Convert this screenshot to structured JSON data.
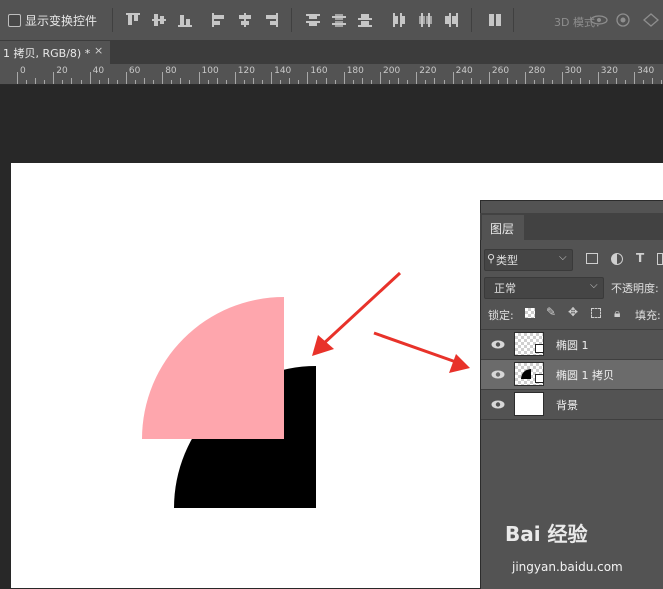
{
  "options_bar": {
    "show_transform_controls_label": "显示变换控件",
    "mode_3d_label": "3D 模式：",
    "align_icons": [
      "align-top-edges-icon",
      "align-vertical-centers-icon",
      "align-bottom-edges-icon",
      "align-left-edges-icon",
      "align-horizontal-centers-icon",
      "align-right-edges-icon"
    ],
    "distribute_icons": [
      "distribute-top-icon",
      "distribute-vcenter-icon",
      "distribute-bottom-icon",
      "distribute-left-icon",
      "distribute-hcenter-icon",
      "distribute-right-icon"
    ]
  },
  "document_tab": {
    "title": "1 拷贝, RGB/8) *",
    "close": "×"
  },
  "ruler": {
    "labels": [
      "0",
      "20",
      "40",
      "60",
      "80",
      "100",
      "120",
      "140",
      "160",
      "180",
      "200",
      "220",
      "240",
      "260",
      "280",
      "300",
      "320",
      "340"
    ]
  },
  "canvas": {
    "pink_shape_color": "#fea6ad",
    "black_shape_color": "#000000",
    "arrow_color": "#e8322a"
  },
  "layers_panel": {
    "tab_label": "图层",
    "filter_label": "类型",
    "blend_mode": "正常",
    "opacity_label": "不透明度:",
    "lock_label": "锁定:",
    "fill_label": "填充:",
    "layers": [
      {
        "name": "椭圆 1",
        "selected": false
      },
      {
        "name": "椭圆 1 拷贝",
        "selected": true
      },
      {
        "name": "背景",
        "selected": false
      }
    ]
  },
  "watermark": {
    "brand": "Bai 经验",
    "url": "jingyan.baidu.com"
  }
}
